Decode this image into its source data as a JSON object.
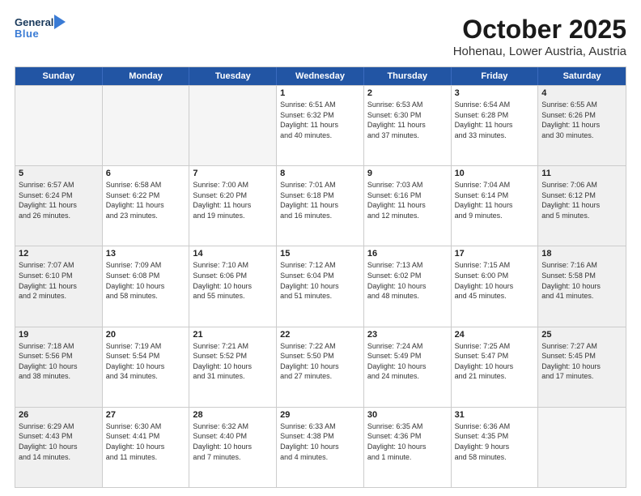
{
  "header": {
    "logo_general": "General",
    "logo_blue": "Blue",
    "title": "October 2025",
    "subtitle": "Hohenau, Lower Austria, Austria"
  },
  "calendar": {
    "days_of_week": [
      "Sunday",
      "Monday",
      "Tuesday",
      "Wednesday",
      "Thursday",
      "Friday",
      "Saturday"
    ],
    "weeks": [
      [
        {
          "day": "",
          "empty": true
        },
        {
          "day": "",
          "empty": true
        },
        {
          "day": "",
          "empty": true
        },
        {
          "day": "1",
          "lines": [
            "Sunrise: 6:51 AM",
            "Sunset: 6:32 PM",
            "Daylight: 11 hours",
            "and 40 minutes."
          ]
        },
        {
          "day": "2",
          "lines": [
            "Sunrise: 6:53 AM",
            "Sunset: 6:30 PM",
            "Daylight: 11 hours",
            "and 37 minutes."
          ]
        },
        {
          "day": "3",
          "lines": [
            "Sunrise: 6:54 AM",
            "Sunset: 6:28 PM",
            "Daylight: 11 hours",
            "and 33 minutes."
          ]
        },
        {
          "day": "4",
          "lines": [
            "Sunrise: 6:55 AM",
            "Sunset: 6:26 PM",
            "Daylight: 11 hours",
            "and 30 minutes."
          ]
        }
      ],
      [
        {
          "day": "5",
          "lines": [
            "Sunrise: 6:57 AM",
            "Sunset: 6:24 PM",
            "Daylight: 11 hours",
            "and 26 minutes."
          ]
        },
        {
          "day": "6",
          "lines": [
            "Sunrise: 6:58 AM",
            "Sunset: 6:22 PM",
            "Daylight: 11 hours",
            "and 23 minutes."
          ]
        },
        {
          "day": "7",
          "lines": [
            "Sunrise: 7:00 AM",
            "Sunset: 6:20 PM",
            "Daylight: 11 hours",
            "and 19 minutes."
          ]
        },
        {
          "day": "8",
          "lines": [
            "Sunrise: 7:01 AM",
            "Sunset: 6:18 PM",
            "Daylight: 11 hours",
            "and 16 minutes."
          ]
        },
        {
          "day": "9",
          "lines": [
            "Sunrise: 7:03 AM",
            "Sunset: 6:16 PM",
            "Daylight: 11 hours",
            "and 12 minutes."
          ]
        },
        {
          "day": "10",
          "lines": [
            "Sunrise: 7:04 AM",
            "Sunset: 6:14 PM",
            "Daylight: 11 hours",
            "and 9 minutes."
          ]
        },
        {
          "day": "11",
          "lines": [
            "Sunrise: 7:06 AM",
            "Sunset: 6:12 PM",
            "Daylight: 11 hours",
            "and 5 minutes."
          ]
        }
      ],
      [
        {
          "day": "12",
          "lines": [
            "Sunrise: 7:07 AM",
            "Sunset: 6:10 PM",
            "Daylight: 11 hours",
            "and 2 minutes."
          ]
        },
        {
          "day": "13",
          "lines": [
            "Sunrise: 7:09 AM",
            "Sunset: 6:08 PM",
            "Daylight: 10 hours",
            "and 58 minutes."
          ]
        },
        {
          "day": "14",
          "lines": [
            "Sunrise: 7:10 AM",
            "Sunset: 6:06 PM",
            "Daylight: 10 hours",
            "and 55 minutes."
          ]
        },
        {
          "day": "15",
          "lines": [
            "Sunrise: 7:12 AM",
            "Sunset: 6:04 PM",
            "Daylight: 10 hours",
            "and 51 minutes."
          ]
        },
        {
          "day": "16",
          "lines": [
            "Sunrise: 7:13 AM",
            "Sunset: 6:02 PM",
            "Daylight: 10 hours",
            "and 48 minutes."
          ]
        },
        {
          "day": "17",
          "lines": [
            "Sunrise: 7:15 AM",
            "Sunset: 6:00 PM",
            "Daylight: 10 hours",
            "and 45 minutes."
          ]
        },
        {
          "day": "18",
          "lines": [
            "Sunrise: 7:16 AM",
            "Sunset: 5:58 PM",
            "Daylight: 10 hours",
            "and 41 minutes."
          ]
        }
      ],
      [
        {
          "day": "19",
          "lines": [
            "Sunrise: 7:18 AM",
            "Sunset: 5:56 PM",
            "Daylight: 10 hours",
            "and 38 minutes."
          ]
        },
        {
          "day": "20",
          "lines": [
            "Sunrise: 7:19 AM",
            "Sunset: 5:54 PM",
            "Daylight: 10 hours",
            "and 34 minutes."
          ]
        },
        {
          "day": "21",
          "lines": [
            "Sunrise: 7:21 AM",
            "Sunset: 5:52 PM",
            "Daylight: 10 hours",
            "and 31 minutes."
          ]
        },
        {
          "day": "22",
          "lines": [
            "Sunrise: 7:22 AM",
            "Sunset: 5:50 PM",
            "Daylight: 10 hours",
            "and 27 minutes."
          ]
        },
        {
          "day": "23",
          "lines": [
            "Sunrise: 7:24 AM",
            "Sunset: 5:49 PM",
            "Daylight: 10 hours",
            "and 24 minutes."
          ]
        },
        {
          "day": "24",
          "lines": [
            "Sunrise: 7:25 AM",
            "Sunset: 5:47 PM",
            "Daylight: 10 hours",
            "and 21 minutes."
          ]
        },
        {
          "day": "25",
          "lines": [
            "Sunrise: 7:27 AM",
            "Sunset: 5:45 PM",
            "Daylight: 10 hours",
            "and 17 minutes."
          ]
        }
      ],
      [
        {
          "day": "26",
          "lines": [
            "Sunrise: 6:29 AM",
            "Sunset: 4:43 PM",
            "Daylight: 10 hours",
            "and 14 minutes."
          ]
        },
        {
          "day": "27",
          "lines": [
            "Sunrise: 6:30 AM",
            "Sunset: 4:41 PM",
            "Daylight: 10 hours",
            "and 11 minutes."
          ]
        },
        {
          "day": "28",
          "lines": [
            "Sunrise: 6:32 AM",
            "Sunset: 4:40 PM",
            "Daylight: 10 hours",
            "and 7 minutes."
          ]
        },
        {
          "day": "29",
          "lines": [
            "Sunrise: 6:33 AM",
            "Sunset: 4:38 PM",
            "Daylight: 10 hours",
            "and 4 minutes."
          ]
        },
        {
          "day": "30",
          "lines": [
            "Sunrise: 6:35 AM",
            "Sunset: 4:36 PM",
            "Daylight: 10 hours",
            "and 1 minute."
          ]
        },
        {
          "day": "31",
          "lines": [
            "Sunrise: 6:36 AM",
            "Sunset: 4:35 PM",
            "Daylight: 9 hours",
            "and 58 minutes."
          ]
        },
        {
          "day": "",
          "empty": true
        }
      ]
    ]
  }
}
